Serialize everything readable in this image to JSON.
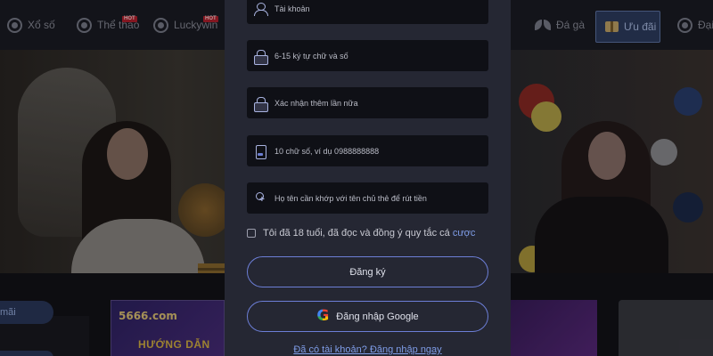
{
  "nav": {
    "items": [
      {
        "label": "Xổ số",
        "icon": "lottery-ball-icon",
        "hot": false
      },
      {
        "label": "Thể thao",
        "icon": "sports-icon",
        "hot": true
      },
      {
        "label": "Luckywin",
        "icon": "luckywin-icon",
        "hot": true
      },
      {
        "label": "Đá gà",
        "icon": "cockfight-icon",
        "hot": false
      },
      {
        "label": "Ưu đãi",
        "icon": "gift-icon",
        "hot": false,
        "active": true
      },
      {
        "label": "Đại",
        "icon": "agent-icon",
        "hot": false
      }
    ],
    "hot_badge": "HOT"
  },
  "register_form": {
    "username_placeholder": "Tài khoản",
    "password_placeholder": "6-15 ký tự chữ và số",
    "confirm_password_placeholder": "Xác nhận thêm lần nữa",
    "phone_placeholder": "10 chữ số, ví dụ 0988888888",
    "fullname_placeholder": "Họ tên cần khớp với tên chủ thẻ để rút tiền",
    "agree_text": "Tôi đã 18 tuổi, đã đọc và đồng ý quy tắc cá ",
    "agree_link": "cược",
    "register_button": "Đăng ký",
    "google_button": "Đăng nhập Google",
    "login_link": "Đã có tài khoản? Đăng nhập ngay"
  },
  "promo": {
    "pill_label": "mãi",
    "card_logo": "5666.com",
    "card_heading": "HƯỚNG DẪN"
  },
  "colors": {
    "accent": "#6c7ed6",
    "link": "#7f9de8",
    "modal_bg": "#252733",
    "nav_bg": "#1b1c24"
  }
}
